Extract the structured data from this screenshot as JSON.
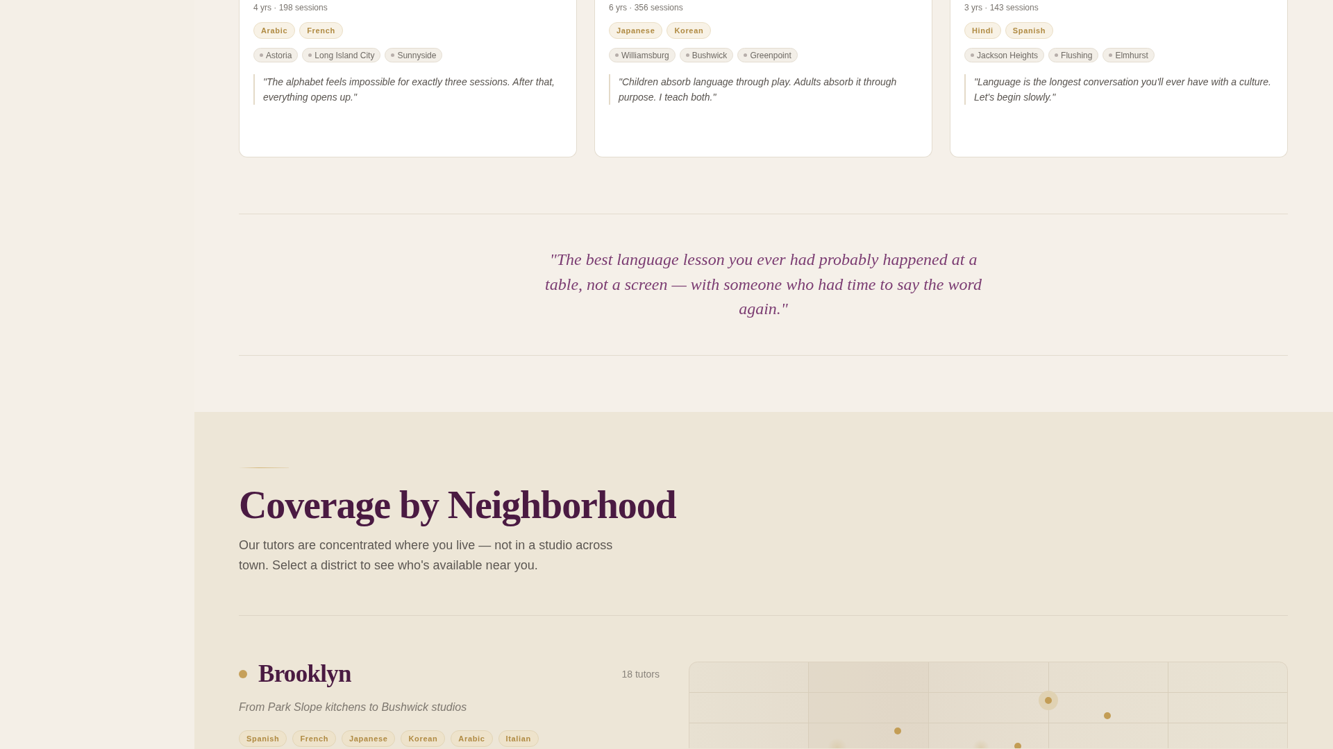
{
  "tutor_cards": [
    {
      "stats": "4 yrs · 198 sessions",
      "languages": [
        "Arabic",
        "French"
      ],
      "neighborhoods": [
        "Astoria",
        "Long Island City",
        "Sunnyside"
      ],
      "quote": "\"The alphabet feels impossible for exactly three sessions. After that, everything opens up.\""
    },
    {
      "stats": "6 yrs · 356 sessions",
      "languages": [
        "Japanese",
        "Korean"
      ],
      "neighborhoods": [
        "Williamsburg",
        "Bushwick",
        "Greenpoint"
      ],
      "quote": "\"Children absorb language through play. Adults absorb it through purpose. I teach both.\""
    },
    {
      "stats": "3 yrs · 143 sessions",
      "languages": [
        "Hindi",
        "Spanish"
      ],
      "neighborhoods": [
        "Jackson Heights",
        "Flushing",
        "Elmhurst"
      ],
      "quote": "\"Language is the longest conversation you'll ever have with a culture. Let's begin slowly.\""
    }
  ],
  "pull_quote": "\"The best language lesson you ever had probably happened at a table, not a screen — with someone who had time to say the word again.\"",
  "coverage": {
    "title": "Coverage by Neighborhood",
    "intro": "Our tutors are concentrated where you live — not in a studio across town. Select a district to see who's available near you.",
    "districts": [
      {
        "name": "Brooklyn",
        "tutor_count": "18 tutors",
        "tagline": "From Park Slope kitchens to Bushwick studios",
        "languages": [
          "Spanish",
          "French",
          "Japanese",
          "Korean",
          "Arabic",
          "Italian"
        ]
      }
    ]
  }
}
